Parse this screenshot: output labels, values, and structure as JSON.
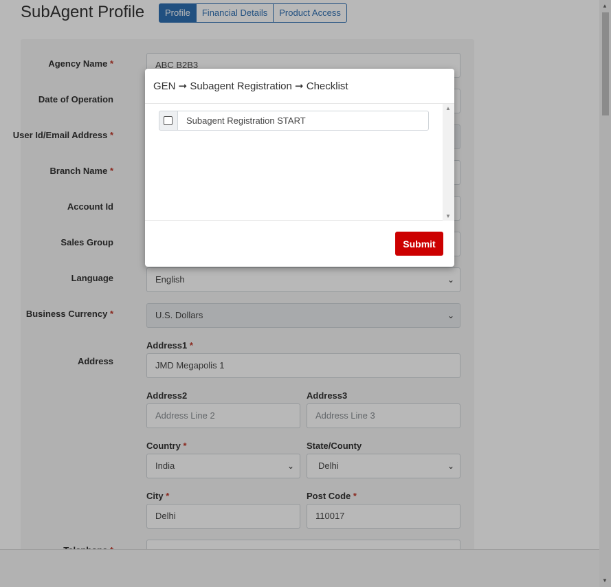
{
  "page": {
    "title": "SubAgent Profile",
    "tabs": [
      {
        "label": "Profile",
        "active": true
      },
      {
        "label": "Financial Details",
        "active": false
      },
      {
        "label": "Product Access",
        "active": false
      }
    ]
  },
  "form": {
    "agency_name": {
      "label": "Agency Name",
      "required_mark": "*",
      "value": "ABC B2B3"
    },
    "date_of_operation": {
      "label": "Date of Operation"
    },
    "user_id": {
      "label": "User Id/Email Address",
      "required_mark": "*"
    },
    "branch_name": {
      "label": "Branch Name",
      "required_mark": "*"
    },
    "account_id": {
      "label": "Account Id"
    },
    "sales_group": {
      "label": "Sales Group"
    },
    "language": {
      "label": "Language",
      "value": "English"
    },
    "business_currency": {
      "label": "Business Currency",
      "required_mark": "*",
      "value": "U.S. Dollars"
    },
    "address": {
      "label": "Address",
      "address1": {
        "label": "Address1",
        "required_mark": "*",
        "value": "JMD Megapolis 1"
      },
      "address2": {
        "label": "Address2",
        "placeholder": "Address Line 2"
      },
      "address3": {
        "label": "Address3",
        "placeholder": "Address Line 3"
      },
      "country": {
        "label": "Country",
        "required_mark": "*",
        "value": "India"
      },
      "state": {
        "label": "State/County",
        "value": "Delhi"
      },
      "city": {
        "label": "City",
        "required_mark": "*",
        "value": "Delhi"
      },
      "post_code": {
        "label": "Post Code",
        "required_mark": "*",
        "value": "110017"
      }
    },
    "telephone": {
      "label": "Telephone",
      "required_mark": "*"
    }
  },
  "modal": {
    "title": "GEN ➞ Subagent Registration ➞ Checklist",
    "items": [
      {
        "label": "Subagent Registration START",
        "checked": false
      }
    ],
    "submit_label": "Submit"
  },
  "icons": {
    "chevron": "chevron-down-icon",
    "scroll_up": "▲",
    "scroll_down": "▼"
  },
  "colors": {
    "primary": "#2f6fb2",
    "submit": "#cc0000",
    "required": "#c0392b"
  }
}
